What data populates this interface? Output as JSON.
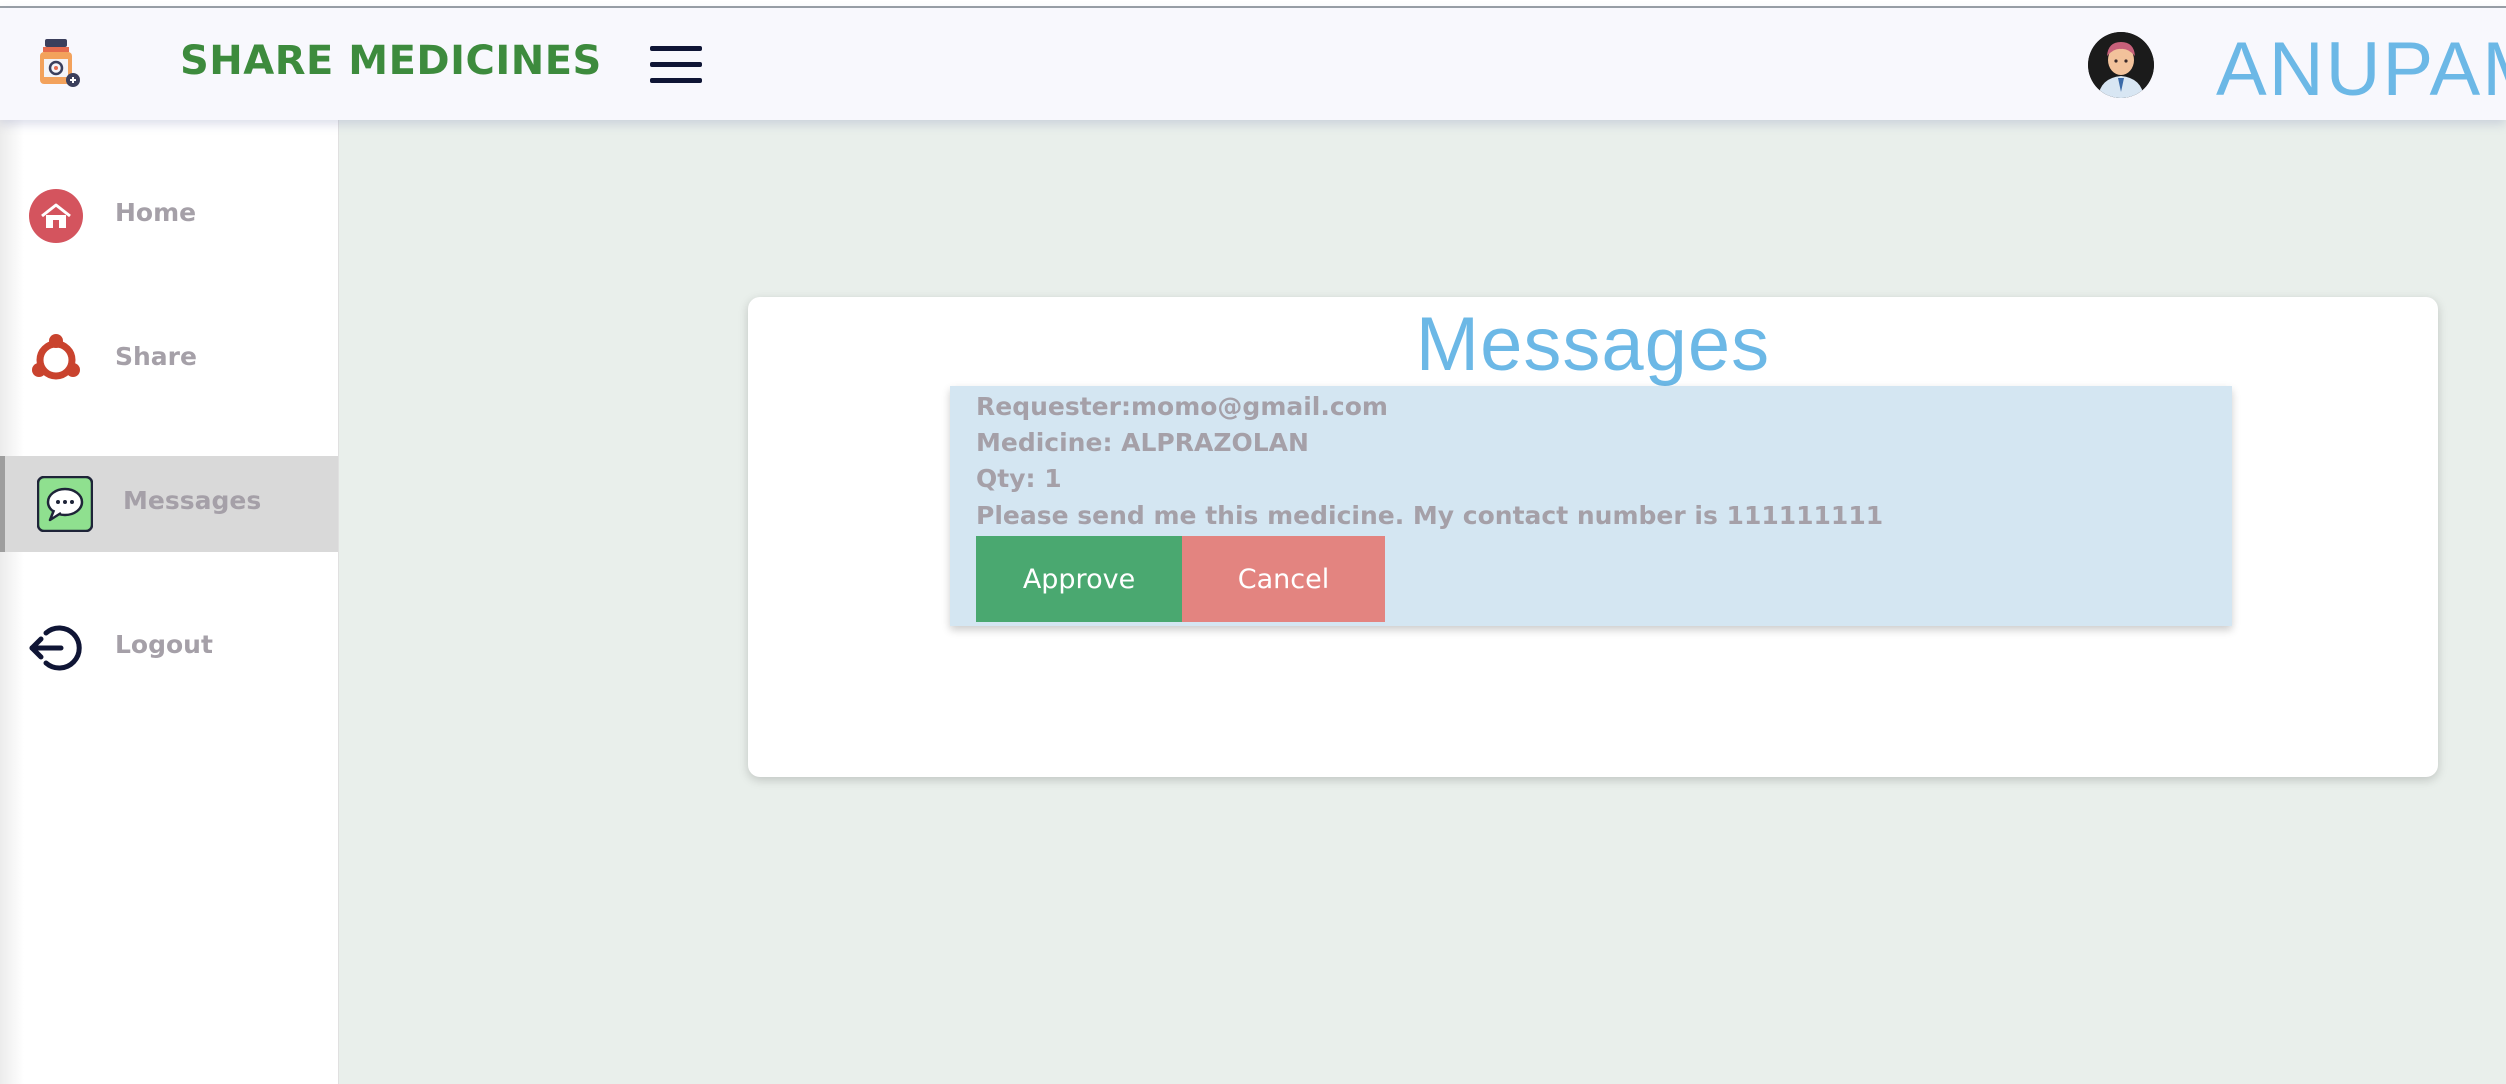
{
  "header": {
    "brand_title": "SHARE MEDICINES",
    "brand_icon": "medicine-bottle-icon",
    "menu_icon": "hamburger-menu-icon",
    "avatar_icon": "user-avatar-icon",
    "username": "ANUPAM",
    "colors": {
      "brand": "#3d8b3d",
      "username": "#6cb8e6",
      "header_bg": "#f8f8fd"
    }
  },
  "sidebar": {
    "items": [
      {
        "label": "Home",
        "icon": "home-icon",
        "active": false
      },
      {
        "label": "Share",
        "icon": "share-icon",
        "active": false
      },
      {
        "label": "Messages",
        "icon": "chat-bubble-icon",
        "active": true
      },
      {
        "label": "Logout",
        "icon": "logout-icon",
        "active": false
      }
    ]
  },
  "main": {
    "title": "Messages",
    "messages": [
      {
        "requester": "Requester:momo@gmail.com",
        "medicine": "Medicine: ALPRAZOLAN",
        "qty": "Qty: 1",
        "note": "Please send me this medicine. My contact number is 111111111",
        "approve_label": "Approve",
        "cancel_label": "Cancel"
      }
    ],
    "colors": {
      "approve": "#4aa870",
      "cancel": "#e38480",
      "message_bg": "#d4e6f2",
      "page_bg": "#e9efeb"
    }
  }
}
